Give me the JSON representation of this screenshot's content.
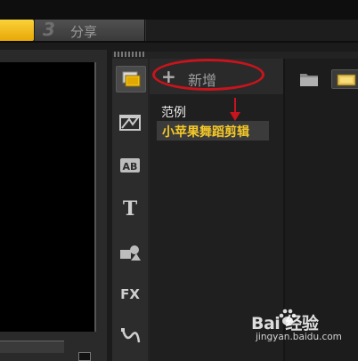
{
  "steps": {
    "current_number": "3",
    "current_label": "分享"
  },
  "library": {
    "add_label": "新增",
    "add_icon": "plus-icon",
    "items": [
      {
        "label": "范例",
        "selected": false
      },
      {
        "label": "小苹果舞蹈剪辑",
        "selected": true
      }
    ],
    "side_icons": [
      "media-icon",
      "transition-icon",
      "title-ab-icon",
      "text-t-icon",
      "graphic-icon",
      "fx-filter-icon",
      "path-icon"
    ]
  },
  "annotation": {
    "ellipse_color": "#c8141c",
    "arrow_color": "#c8141c"
  },
  "colors": {
    "accent_step": "#f1c21f",
    "selected_text": "#f6c928"
  },
  "watermark": {
    "logo_text": "Bai    经验",
    "url": "jingyan.baidu.com"
  }
}
